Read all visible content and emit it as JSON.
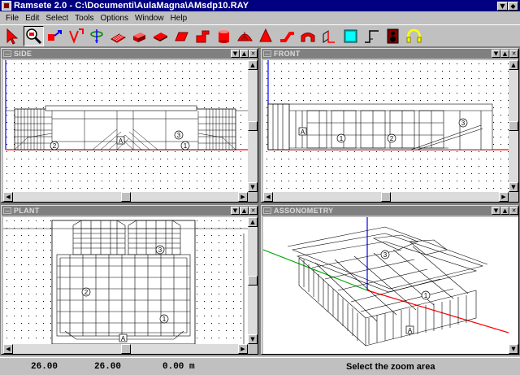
{
  "app": {
    "title": "Ramsete 2.0 - C:\\Documenti\\AulaMagna\\AMsdp10.RAY",
    "buttons": {
      "minimize": "▼",
      "maximize": "▲",
      "restore": "◆"
    }
  },
  "menu": [
    "File",
    "Edit",
    "Select",
    "Tools",
    "Options",
    "Window",
    "Help"
  ],
  "toolbar": {
    "tools": [
      "select-arrow-icon",
      "zoom-area-icon",
      "move-icon",
      "edit-node-icon",
      "rotate-icon",
      "plane-icon",
      "box-icon",
      "slab-icon",
      "wedge-icon",
      "step-icon",
      "cylinder-icon",
      "dome-icon",
      "cone-icon",
      "pipe-icon",
      "arch-icon",
      "wall-icon",
      "panel-icon",
      "stair-icon",
      "speaker-icon",
      "headphones-icon"
    ],
    "active": "zoom-area-icon"
  },
  "windows": {
    "side": "SIDE",
    "front": "FRONT",
    "plant": "PLANT",
    "assonometry": "ASSONOMETRY"
  },
  "scroll_arrows": {
    "left": "◀",
    "right": "▶",
    "up": "▲",
    "down": "▼"
  },
  "labels": {
    "side": [
      "A",
      "1",
      "2",
      "3"
    ],
    "front": [
      "A",
      "1",
      "2",
      "3"
    ],
    "plant": [
      "A",
      "1",
      "2",
      "3"
    ],
    "assonometry": [
      "A",
      "1",
      "3"
    ]
  },
  "status": {
    "x": "26.00",
    "y": "26.00",
    "z": "0.00 m",
    "message": "Select the zoom area"
  },
  "colors": {
    "title_active": "#000080",
    "axis_x": "#ff0000",
    "axis_y": "#00aa00",
    "axis_z": "#0000ff"
  }
}
